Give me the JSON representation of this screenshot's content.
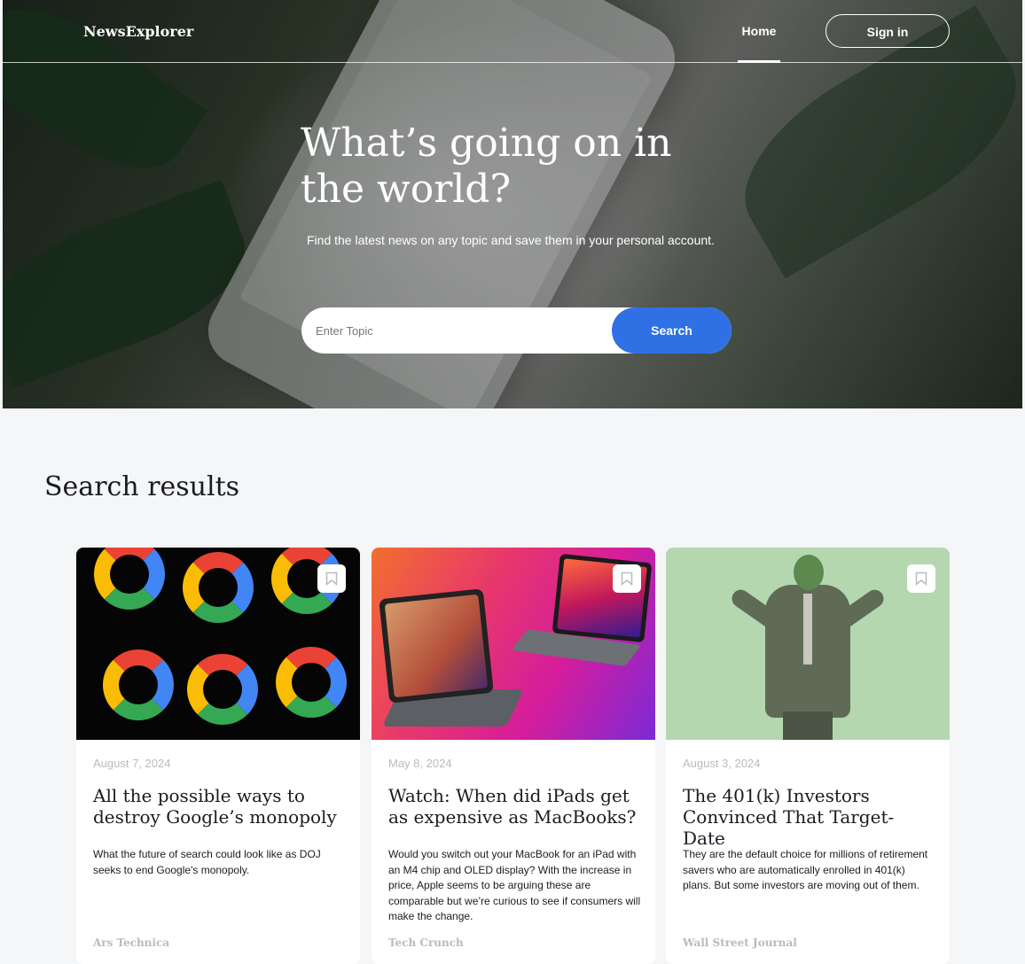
{
  "header": {
    "logo": "NewsExplorer",
    "nav_home": "Home",
    "sign_in": "Sign in"
  },
  "hero": {
    "title": "What’s going on in the world?",
    "subtitle": "Find the latest news on any topic and save them in your personal account.",
    "search_placeholder": "Enter Topic",
    "search_button": "Search"
  },
  "results": {
    "title": "Search results",
    "cards": [
      {
        "date": "August 7, 2024",
        "title": "All the possible ways to destroy Google’s monopoly",
        "text": "What the future of search could look like as DOJ seeks to end Google's monopoly.",
        "source": "Ars Technica",
        "image_icon": "google-logo-image"
      },
      {
        "date": "May 8, 2024",
        "title": "Watch: When did iPads get as expensive as MacBooks?",
        "text": "Would you switch out your MacBook for an iPad with an M4 chip and OLED display? With the increase in price, Apple seems to be arguing these are comparable but we’re curious to see if consumers will make the change.",
        "source": "Tech Crunch",
        "image_icon": "ipad-macbook-image"
      },
      {
        "date": "August 3, 2024",
        "title": "The 401(k) Investors Convinced That Target-Date",
        "text": "They are the default choice for millions of retirement savers who are automatically enrolled in 401(k) plans. But some investors are moving out of them.",
        "source": "Wall Street Journal",
        "image_icon": "franklin-suit-image"
      }
    ]
  },
  "colors": {
    "accent": "#2f71e5",
    "muted": "#b6bcbf",
    "text": "#1a1b22",
    "background": "#f5f6f7"
  }
}
